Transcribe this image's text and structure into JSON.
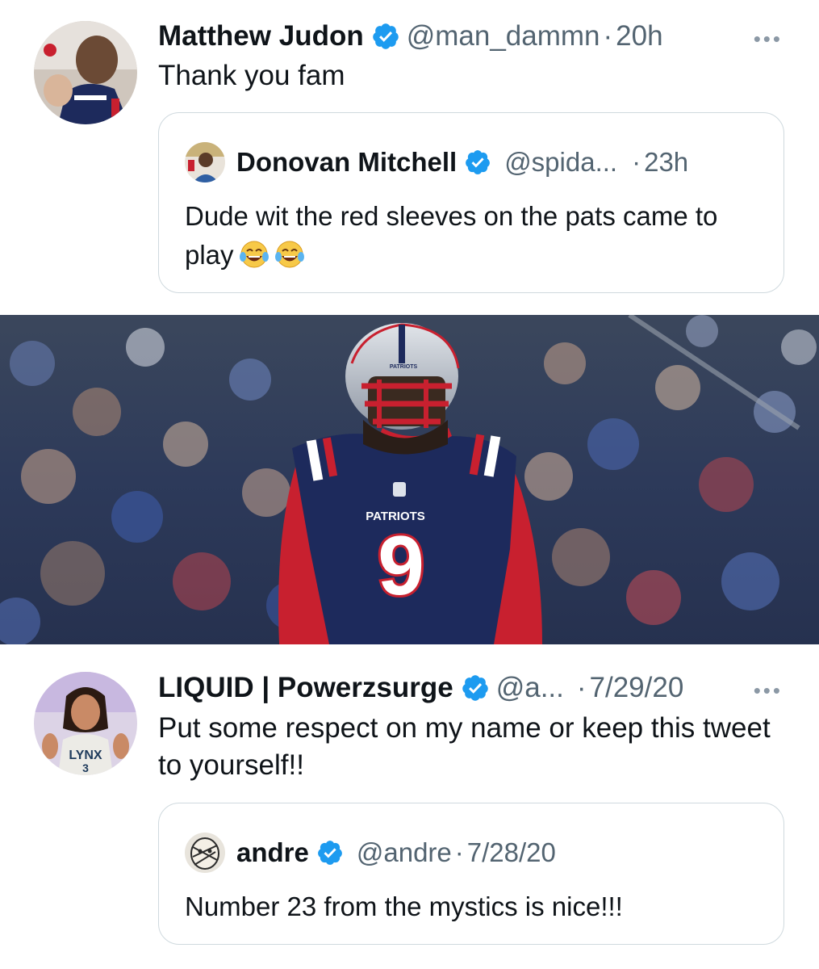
{
  "tweets": [
    {
      "author": "Matthew Judon",
      "handle": "@man_dammn",
      "separator": "·",
      "time": "20h",
      "more": "•••",
      "text": "Thank you fam",
      "quote": {
        "author": "Donovan Mitchell",
        "handle": "@spida...",
        "separator": "·",
        "time": "23h",
        "text": "Dude wit the red sleeves on the pats came to play",
        "emoji": [
          "tears-of-joy",
          "tears-of-joy"
        ]
      },
      "photo": {
        "jersey_number": "9",
        "jersey_wordmark": "PATRIOTS",
        "helmet_wordmark": "PATRIOTS",
        "team_colors": {
          "navy": "#1d2a5c",
          "red": "#c8202f",
          "silver": "#b0b7c3"
        }
      }
    },
    {
      "author": "LIQUID | Powerzsurge",
      "handle": "@a...",
      "separator": "·",
      "time": "7/29/20",
      "more": "•••",
      "text": "Put some respect on my name or keep this tweet to yourself!!",
      "avatar_jersey": {
        "team": "LYNX",
        "number": "3"
      },
      "quote": {
        "author": "andre",
        "handle": "@andre",
        "separator": "·",
        "time": "7/28/20",
        "text": "Number 23 from the mystics is nice!!!"
      }
    }
  ],
  "colors": {
    "verified": "#1d9bf0",
    "muted": "#536471",
    "border": "#cfd9de",
    "text": "#0f1419"
  }
}
